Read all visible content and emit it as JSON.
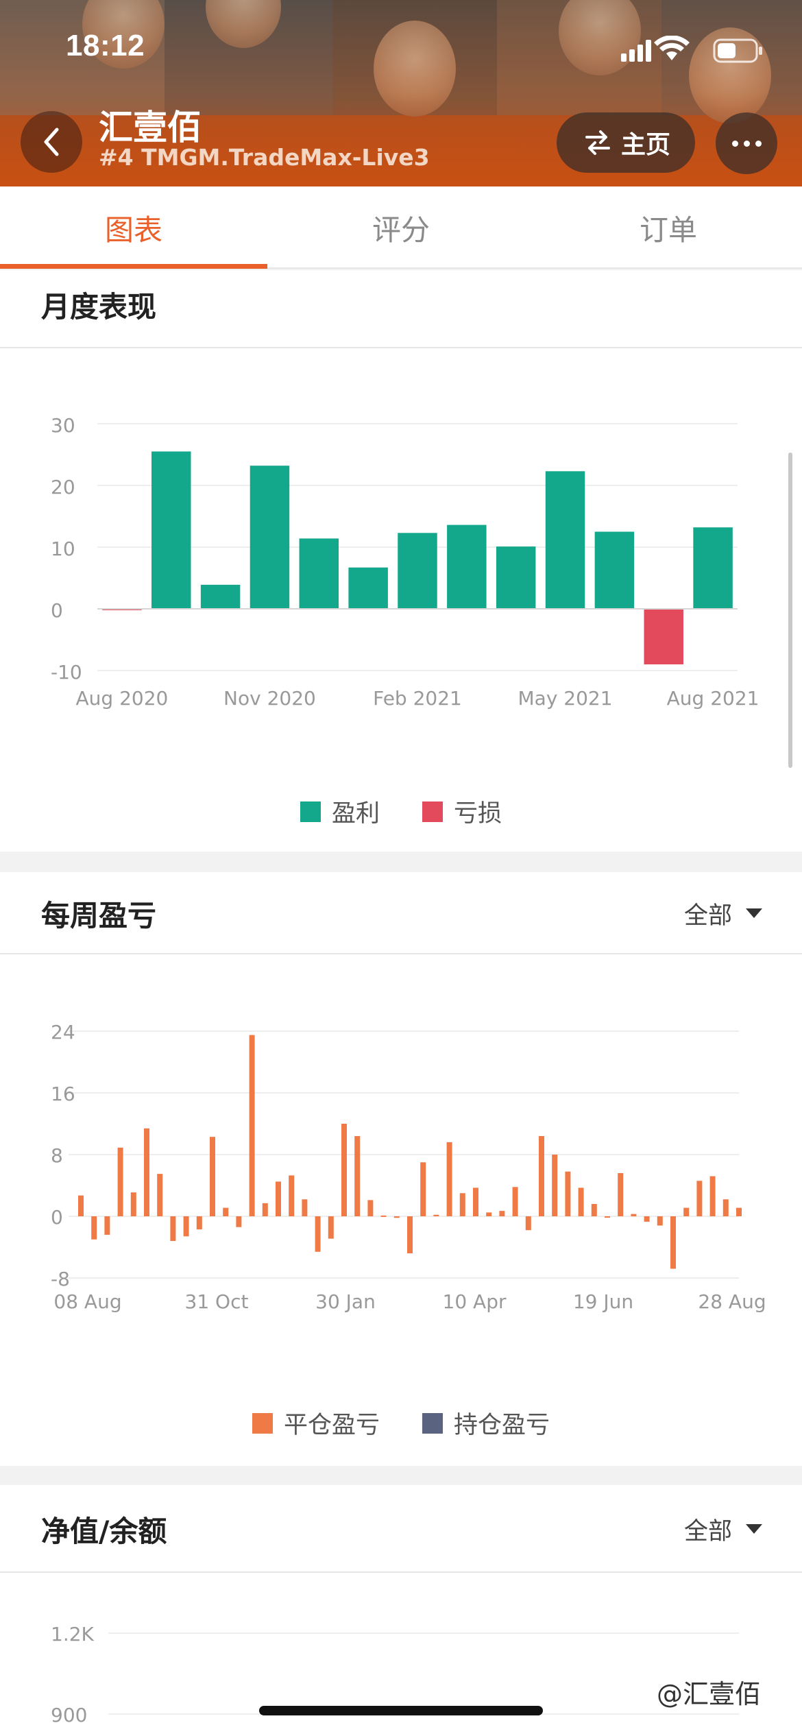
{
  "status_bar": {
    "time": "18:12"
  },
  "header": {
    "title": "汇壹佰",
    "subtitle": "#4 TMGM.TradeMax-Live3",
    "home_label": "主页",
    "accent": "#e9602a"
  },
  "tabs": [
    {
      "label": "图表",
      "active": true
    },
    {
      "label": "评分",
      "active": false
    },
    {
      "label": "订单",
      "active": false
    }
  ],
  "monthly": {
    "title": "月度表现",
    "legend": {
      "profit": "盈利",
      "loss": "亏损"
    },
    "colors": {
      "profit": "#13a88b",
      "loss": "#e34a5c"
    },
    "chart_data": {
      "type": "bar",
      "categories": [
        "Aug 2020",
        "Sep 2020",
        "Oct 2020",
        "Nov 2020",
        "Dec 2020",
        "Jan 2021",
        "Feb 2021",
        "Mar 2021",
        "Apr 2021",
        "May 2021",
        "Jun 2021",
        "Jul 2021",
        "Aug 2021"
      ],
      "values": [
        -0.2,
        25.5,
        3.9,
        23.2,
        11.4,
        6.7,
        12.3,
        13.6,
        10.1,
        22.3,
        12.5,
        -9.0,
        13.2
      ],
      "x_tick_labels": [
        "Aug 2020",
        "Nov 2020",
        "Feb 2021",
        "May 2021",
        "Aug 2021"
      ],
      "y_ticks": [
        "30",
        "20",
        "10",
        "0",
        "-10"
      ],
      "ylim": [
        -10,
        30
      ],
      "grid": true
    }
  },
  "weekly": {
    "title": "每周盈亏",
    "filter": "全部",
    "legend": {
      "closed": "平仓盈亏",
      "open": "持仓盈亏"
    },
    "colors": {
      "closed": "#f07a45",
      "open": "#5a6480"
    },
    "chart_data": {
      "type": "bar",
      "x_tick_labels": [
        "08 Aug",
        "31 Oct",
        "30 Jan",
        "10 Apr",
        "19 Jun",
        "28 Aug"
      ],
      "y_ticks": [
        "24",
        "16",
        "8",
        "0",
        "-8"
      ],
      "ylim": [
        -8,
        24
      ],
      "series": [
        {
          "name": "平仓盈亏",
          "values": [
            2.7,
            -3.0,
            -2.4,
            8.9,
            3.1,
            11.4,
            5.5,
            -3.2,
            -2.6,
            -1.7,
            10.3,
            1.1,
            -1.4,
            23.5,
            1.7,
            4.5,
            5.3,
            2.2,
            -4.6,
            -2.9,
            12.0,
            10.4,
            2.1,
            0.1,
            -0.2,
            -4.8,
            7.0,
            0.2,
            9.6,
            3.0,
            3.7,
            0.5,
            0.7,
            3.8,
            -1.8,
            10.4,
            8.0,
            5.8,
            3.7,
            1.6,
            -0.1,
            5.6,
            0.3,
            -0.7,
            -1.2,
            -6.8,
            1.1,
            4.6,
            5.2,
            2.2,
            1.1
          ]
        },
        {
          "name": "持仓盈亏",
          "values": []
        }
      ],
      "grid": true
    }
  },
  "equity": {
    "title": "净值/余额",
    "filter": "全部",
    "chart_data": {
      "type": "line",
      "y_ticks": [
        "1.2K",
        "900"
      ]
    }
  },
  "watermark": "@汇壹佰"
}
